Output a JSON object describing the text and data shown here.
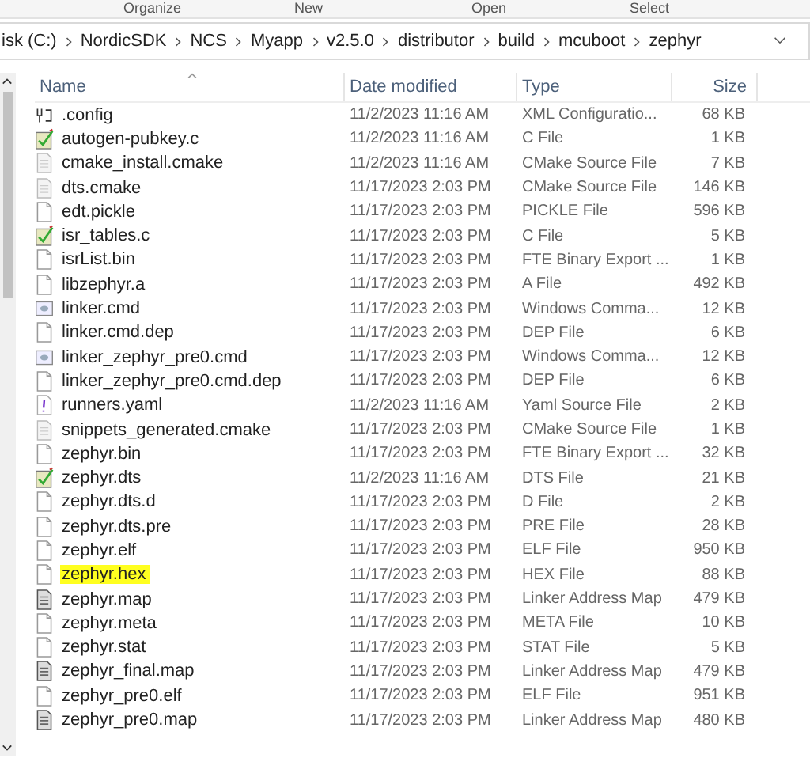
{
  "ribbon": {
    "groups": [
      "Organize",
      "New",
      "Open",
      "Select"
    ]
  },
  "address_bar": {
    "path": [
      "isk (C:)",
      "NordicSDK",
      "NCS",
      "Myapp",
      "v2.5.0",
      "distributor",
      "build",
      "mcuboot",
      "zephyr"
    ]
  },
  "table": {
    "columns": [
      "Name",
      "Date modified",
      "Type",
      "Size"
    ],
    "rows": [
      {
        "kind": "config",
        "name": ".config",
        "date": "11/2/2023 11:16 AM",
        "type": "XML Configuratio...",
        "size": "68 KB",
        "highlighted": false
      },
      {
        "kind": "source",
        "name": "autogen-pubkey.c",
        "date": "11/2/2023 11:16 AM",
        "type": "C File",
        "size": "1 KB",
        "highlighted": false
      },
      {
        "kind": "text",
        "name": "cmake_install.cmake",
        "date": "11/2/2023 11:16 AM",
        "type": "CMake Source File",
        "size": "7 KB",
        "highlighted": false
      },
      {
        "kind": "text",
        "name": "dts.cmake",
        "date": "11/17/2023 2:03 PM",
        "type": "CMake Source File",
        "size": "146 KB",
        "highlighted": false
      },
      {
        "kind": "blank",
        "name": "edt.pickle",
        "date": "11/17/2023 2:03 PM",
        "type": "PICKLE File",
        "size": "596 KB",
        "highlighted": false
      },
      {
        "kind": "source",
        "name": "isr_tables.c",
        "date": "11/17/2023 2:03 PM",
        "type": "C File",
        "size": "5 KB",
        "highlighted": false
      },
      {
        "kind": "blank",
        "name": "isrList.bin",
        "date": "11/17/2023 2:03 PM",
        "type": "FTE Binary Export ...",
        "size": "1 KB",
        "highlighted": false
      },
      {
        "kind": "blank",
        "name": "libzephyr.a",
        "date": "11/17/2023 2:03 PM",
        "type": "A File",
        "size": "492 KB",
        "highlighted": false
      },
      {
        "kind": "command",
        "name": "linker.cmd",
        "date": "11/17/2023 2:03 PM",
        "type": "Windows Comma...",
        "size": "12 KB",
        "highlighted": false
      },
      {
        "kind": "blank",
        "name": "linker.cmd.dep",
        "date": "11/17/2023 2:03 PM",
        "type": "DEP File",
        "size": "6 KB",
        "highlighted": false
      },
      {
        "kind": "command",
        "name": "linker_zephyr_pre0.cmd",
        "date": "11/17/2023 2:03 PM",
        "type": "Windows Comma...",
        "size": "12 KB",
        "highlighted": false
      },
      {
        "kind": "blank",
        "name": "linker_zephyr_pre0.cmd.dep",
        "date": "11/17/2023 2:03 PM",
        "type": "DEP File",
        "size": "6 KB",
        "highlighted": false
      },
      {
        "kind": "yaml",
        "name": "runners.yaml",
        "date": "11/2/2023 11:16 AM",
        "type": "Yaml Source File",
        "size": "2 KB",
        "highlighted": false
      },
      {
        "kind": "text",
        "name": "snippets_generated.cmake",
        "date": "11/17/2023 2:03 PM",
        "type": "CMake Source File",
        "size": "1 KB",
        "highlighted": false
      },
      {
        "kind": "blank",
        "name": "zephyr.bin",
        "date": "11/17/2023 2:03 PM",
        "type": "FTE Binary Export ...",
        "size": "32 KB",
        "highlighted": false
      },
      {
        "kind": "source",
        "name": "zephyr.dts",
        "date": "11/2/2023 11:16 AM",
        "type": "DTS File",
        "size": "21 KB",
        "highlighted": false
      },
      {
        "kind": "blank",
        "name": "zephyr.dts.d",
        "date": "11/17/2023 2:03 PM",
        "type": "D File",
        "size": "2 KB",
        "highlighted": false
      },
      {
        "kind": "blank",
        "name": "zephyr.dts.pre",
        "date": "11/17/2023 2:03 PM",
        "type": "PRE File",
        "size": "28 KB",
        "highlighted": false
      },
      {
        "kind": "blank",
        "name": "zephyr.elf",
        "date": "11/17/2023 2:03 PM",
        "type": "ELF File",
        "size": "950 KB",
        "highlighted": false
      },
      {
        "kind": "blank",
        "name": "zephyr.hex",
        "date": "11/17/2023 2:03 PM",
        "type": "HEX File",
        "size": "88 KB",
        "highlighted": true
      },
      {
        "kind": "map",
        "name": "zephyr.map",
        "date": "11/17/2023 2:03 PM",
        "type": "Linker Address Map",
        "size": "479 KB",
        "highlighted": false
      },
      {
        "kind": "blank",
        "name": "zephyr.meta",
        "date": "11/17/2023 2:03 PM",
        "type": "META File",
        "size": "10 KB",
        "highlighted": false
      },
      {
        "kind": "blank",
        "name": "zephyr.stat",
        "date": "11/17/2023 2:03 PM",
        "type": "STAT File",
        "size": "5 KB",
        "highlighted": false
      },
      {
        "kind": "map",
        "name": "zephyr_final.map",
        "date": "11/17/2023 2:03 PM",
        "type": "Linker Address Map",
        "size": "479 KB",
        "highlighted": false
      },
      {
        "kind": "blank",
        "name": "zephyr_pre0.elf",
        "date": "11/17/2023 2:03 PM",
        "type": "ELF File",
        "size": "951 KB",
        "highlighted": false
      },
      {
        "kind": "map",
        "name": "zephyr_pre0.map",
        "date": "11/17/2023 2:03 PM",
        "type": "Linker Address Map",
        "size": "480 KB",
        "highlighted": false
      }
    ]
  }
}
